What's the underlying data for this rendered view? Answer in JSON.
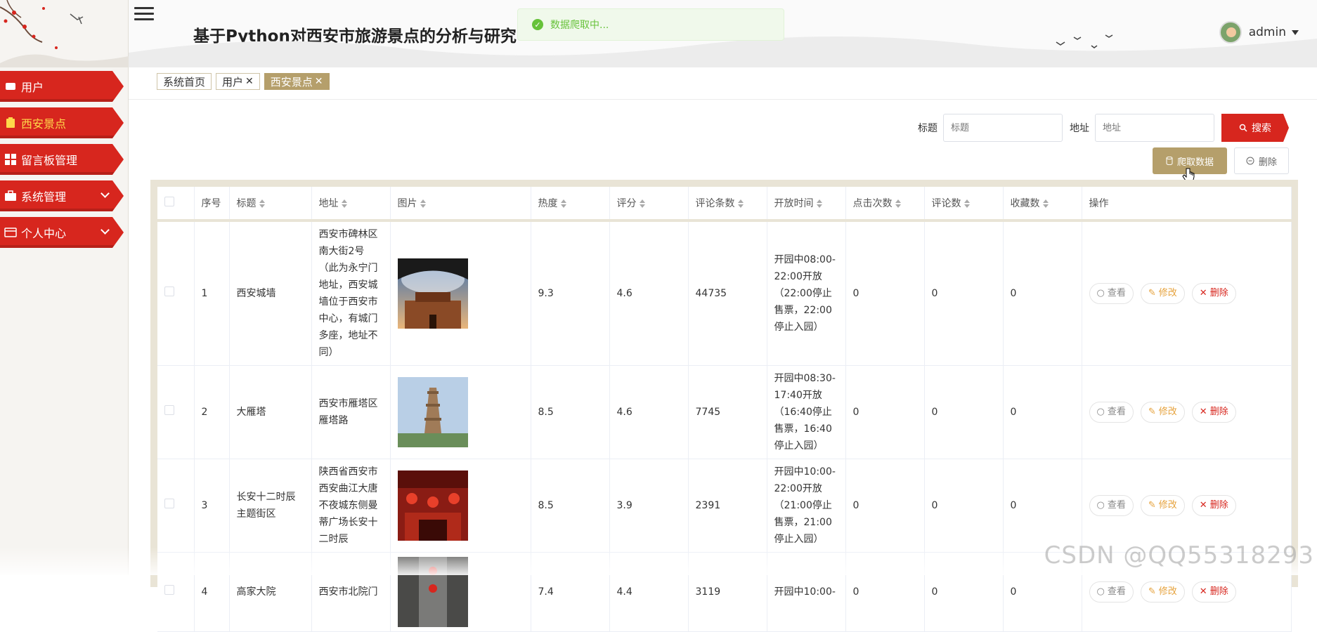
{
  "header": {
    "title": "基于Python对西安市旅游景点的分析与研究",
    "user_name": "admin"
  },
  "toast": {
    "message": "数据爬取中..."
  },
  "sidebar": {
    "items": [
      {
        "label": "用户",
        "icon": "user-icon",
        "active": false,
        "expandable": false
      },
      {
        "label": "西安景点",
        "icon": "clipboard-icon",
        "active": true,
        "expandable": false
      },
      {
        "label": "留言板管理",
        "icon": "grid-icon",
        "active": false,
        "expandable": false
      },
      {
        "label": "系统管理",
        "icon": "briefcase-icon",
        "active": false,
        "expandable": true
      },
      {
        "label": "个人中心",
        "icon": "card-icon",
        "active": false,
        "expandable": true
      }
    ]
  },
  "tabs": [
    {
      "label": "系统首页",
      "closable": false,
      "active": false
    },
    {
      "label": "用户",
      "closable": true,
      "active": false
    },
    {
      "label": "西安景点",
      "closable": true,
      "active": true
    }
  ],
  "tab_close": "✕",
  "search": {
    "title_label": "标题",
    "title_placeholder": "标题",
    "address_label": "地址",
    "address_placeholder": "地址",
    "search_button": "搜索"
  },
  "actions": {
    "crawl": "爬取数据",
    "delete": "删除"
  },
  "table": {
    "columns": [
      "序号",
      "标题",
      "地址",
      "图片",
      "热度",
      "评分",
      "评论条数",
      "开放时间",
      "点击次数",
      "评论数",
      "收藏数",
      "操作"
    ],
    "row_actions": {
      "view": "查看",
      "edit": "修改",
      "delete": "删除"
    },
    "rows": [
      {
        "index": "1",
        "title": "西安城墙",
        "address": "西安市碑林区南大街2号（此为永宁门地址，西安城墙位于西安市中心，有城门多座，地址不同）",
        "heat": "9.3",
        "score": "4.6",
        "comment_count": "44735",
        "open_time": "开园中08:00-22:00开放（22:00停止售票，22:00停止入园）",
        "clicks": "0",
        "comments": "0",
        "favorites": "0"
      },
      {
        "index": "2",
        "title": "大雁塔",
        "address": "西安市雁塔区雁塔路",
        "heat": "8.5",
        "score": "4.6",
        "comment_count": "7745",
        "open_time": "开园中08:30-17:40开放（16:40停止售票，16:40停止入园）",
        "clicks": "0",
        "comments": "0",
        "favorites": "0"
      },
      {
        "index": "3",
        "title": "长安十二时辰主题街区",
        "address": "陕西省西安市西安曲江大唐不夜城东侧曼蒂广场长安十二时辰",
        "heat": "8.5",
        "score": "3.9",
        "comment_count": "2391",
        "open_time": "开园中10:00-22:00开放（21:00停止售票，21:00停止入园）",
        "clicks": "0",
        "comments": "0",
        "favorites": "0"
      },
      {
        "index": "4",
        "title": "高家大院",
        "address": "西安市北院门",
        "heat": "7.4",
        "score": "4.4",
        "comment_count": "3119",
        "open_time": "开园中10:00-",
        "clicks": "0",
        "comments": "0",
        "favorites": "0"
      }
    ]
  },
  "watermark": "CSDN @QQ55318293",
  "colors": {
    "primary_red": "#d7261e",
    "gold": "#b59f6b",
    "success": "#67c23a"
  }
}
